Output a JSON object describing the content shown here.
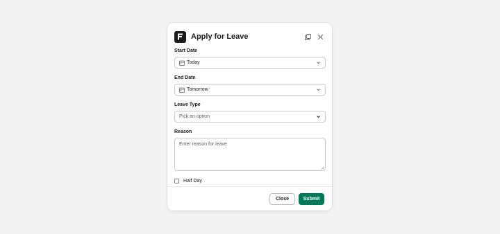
{
  "modal": {
    "title": "Apply for Leave",
    "app_icon": "app-logo-icon",
    "header_icons": [
      "popout-icon",
      "close-icon"
    ],
    "fields": {
      "start_date": {
        "label": "Start Date",
        "value": "Today",
        "icon": "calendar-icon"
      },
      "end_date": {
        "label": "End Date",
        "value": "Tomorrow",
        "icon": "calendar-icon"
      },
      "leave_type": {
        "label": "Leave Type",
        "placeholder": "Pick an option"
      },
      "reason": {
        "label": "Reason",
        "placeholder": "Enter reason for leave"
      },
      "half_day": {
        "label": "Half Day",
        "checked": false
      }
    },
    "footer": {
      "close_label": "Close",
      "submit_label": "Submit"
    }
  },
  "colors": {
    "background": "#f3f3f4",
    "submit": "#007a5a",
    "text": "#1d1c1d"
  }
}
